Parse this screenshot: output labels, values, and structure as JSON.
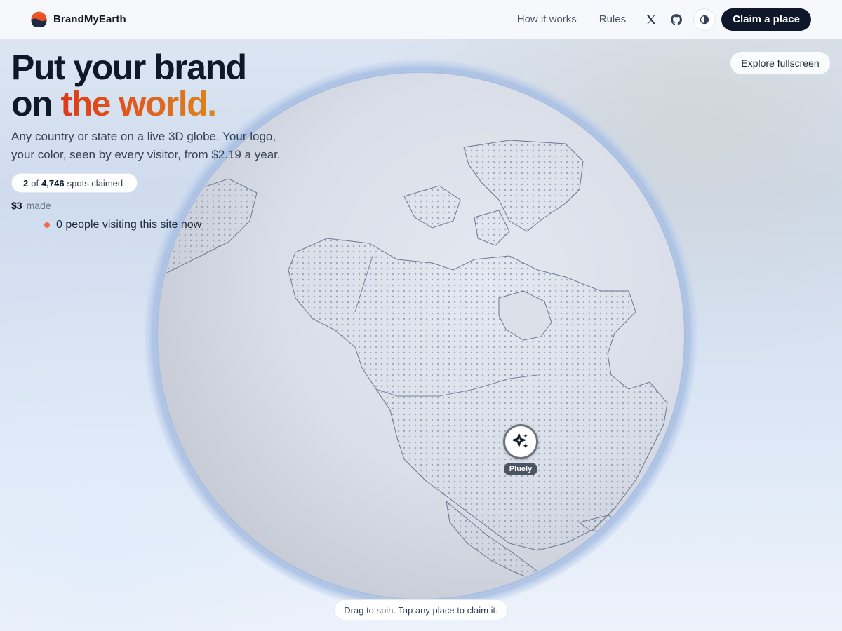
{
  "header": {
    "brand_name": "BrandMyEarth",
    "nav": [
      {
        "label": "How it works"
      },
      {
        "label": "Rules"
      }
    ],
    "icons": [
      "x-logo-icon",
      "github-icon",
      "contrast-icon"
    ],
    "cta_label": "Claim a place"
  },
  "hero": {
    "title_line1": "Put your brand",
    "title_on": "on ",
    "title_accent": "the world.",
    "subtitle": "Any country or state on a live 3D globe. Your logo, your color, seen by every visitor, from $2.19 a year.",
    "claimed_count": "2",
    "claimed_of": "of",
    "total_spots": "4,746",
    "claimed_suffix": "spots claimed",
    "revenue": "$3",
    "revenue_suffix": "made",
    "visitors_text": "0 people visiting this site now"
  },
  "explore_label": "Explore fullscreen",
  "marker": {
    "label": "Pluely",
    "icon": "sparkles-icon"
  },
  "hint": "Drag to spin. Tap any place to claim it.",
  "colors": {
    "accent_start": "#dc3a1a",
    "accent_end": "#d9881e",
    "cta_bg": "#0f172a",
    "visitor_dot": "#ef6c4d"
  }
}
